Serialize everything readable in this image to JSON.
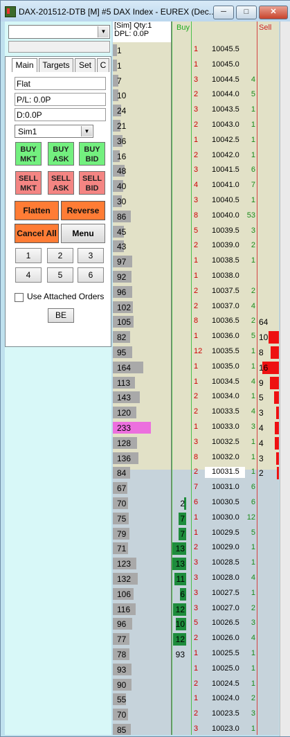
{
  "window": {
    "title": "DAX-201512-DTB [M]  #5  DAX Index - EUREX (Dec...",
    "min_label": "─",
    "max_label": "□",
    "close_label": "✕"
  },
  "left": {
    "account_combo": "",
    "tabs": [
      "Main",
      "Targets",
      "Set",
      "C"
    ],
    "position": "Flat",
    "pl": "P/L: 0.0P",
    "d": "D:0.0P",
    "account": "Sim1",
    "buy_mkt": [
      "BUY",
      "MKT"
    ],
    "buy_ask": [
      "BUY",
      "ASK"
    ],
    "buy_bid": [
      "BUY",
      "BID"
    ],
    "sell_mkt": [
      "SELL",
      "MKT"
    ],
    "sell_ask": [
      "SELL",
      "ASK"
    ],
    "sell_bid": [
      "SELL",
      "BID"
    ],
    "flatten": "Flatten",
    "reverse": "Reverse",
    "cancel_all": "Cancel All",
    "menu": "Menu",
    "qty_buttons": [
      "1",
      "2",
      "3",
      "4",
      "5",
      "6"
    ],
    "use_attached": "Use Attached Orders",
    "be": "BE"
  },
  "ladder": {
    "header_sim": "[Sim]  Qty:1",
    "header_dpl": "DPL: 0.0P",
    "buy_header": "Buy",
    "sell_header": "Sell",
    "colors": {
      "bid": "#cc0000",
      "ask": "#1a8a1a",
      "buy_bar": "#1e8c3c",
      "sell_bar": "#ee1111",
      "highlight": "#ec6fde"
    },
    "rows": [
      {
        "vol": "1",
        "price": "10045.5",
        "bid": "1",
        "ask": "",
        "buy": "",
        "sell": ""
      },
      {
        "vol": "1",
        "price": "10045.0",
        "bid": "1",
        "ask": "",
        "buy": "",
        "sell": ""
      },
      {
        "vol": "7",
        "price": "10044.5",
        "bid": "3",
        "ask": "4",
        "buy": "",
        "sell": ""
      },
      {
        "vol": "10",
        "price": "10044.0",
        "bid": "2",
        "ask": "5",
        "buy": "",
        "sell": ""
      },
      {
        "vol": "24",
        "price": "10043.5",
        "bid": "3",
        "ask": "1",
        "buy": "",
        "sell": ""
      },
      {
        "vol": "21",
        "price": "10043.0",
        "bid": "2",
        "ask": "1",
        "buy": "",
        "sell": ""
      },
      {
        "vol": "36",
        "price": "10042.5",
        "bid": "1",
        "ask": "1",
        "buy": "",
        "sell": ""
      },
      {
        "vol": "16",
        "price": "10042.0",
        "bid": "2",
        "ask": "1",
        "buy": "",
        "sell": ""
      },
      {
        "vol": "48",
        "price": "10041.5",
        "bid": "3",
        "ask": "6",
        "buy": "",
        "sell": ""
      },
      {
        "vol": "40",
        "price": "10041.0",
        "bid": "4",
        "ask": "7",
        "buy": "",
        "sell": ""
      },
      {
        "vol": "30",
        "price": "10040.5",
        "bid": "3",
        "ask": "1",
        "buy": "",
        "sell": ""
      },
      {
        "vol": "86",
        "price": "10040.0",
        "bid": "8",
        "ask": "53",
        "buy": "",
        "sell": ""
      },
      {
        "vol": "45",
        "price": "10039.5",
        "bid": "5",
        "ask": "3",
        "buy": "",
        "sell": ""
      },
      {
        "vol": "43",
        "price": "10039.0",
        "bid": "2",
        "ask": "2",
        "buy": "",
        "sell": ""
      },
      {
        "vol": "97",
        "price": "10038.5",
        "bid": "1",
        "ask": "1",
        "buy": "",
        "sell": ""
      },
      {
        "vol": "92",
        "price": "10038.0",
        "bid": "1",
        "ask": "",
        "buy": "",
        "sell": ""
      },
      {
        "vol": "96",
        "price": "10037.5",
        "bid": "2",
        "ask": "2",
        "buy": "",
        "sell": ""
      },
      {
        "vol": "102",
        "price": "10037.0",
        "bid": "2",
        "ask": "4",
        "buy": "",
        "sell": ""
      },
      {
        "vol": "105",
        "price": "10036.5",
        "bid": "8",
        "ask": "2",
        "buy": "",
        "sell": "64"
      },
      {
        "vol": "82",
        "price": "10036.0",
        "bid": "1",
        "ask": "5",
        "buy": "",
        "sell": "10"
      },
      {
        "vol": "95",
        "price": "10035.5",
        "bid": "12",
        "ask": "1",
        "buy": "",
        "sell": "8"
      },
      {
        "vol": "164",
        "price": "10035.0",
        "bid": "1",
        "ask": "1",
        "buy": "",
        "sell": "16"
      },
      {
        "vol": "113",
        "price": "10034.5",
        "bid": "1",
        "ask": "4",
        "buy": "",
        "sell": "9"
      },
      {
        "vol": "143",
        "price": "10034.0",
        "bid": "2",
        "ask": "1",
        "buy": "",
        "sell": "5"
      },
      {
        "vol": "120",
        "price": "10033.5",
        "bid": "2",
        "ask": "4",
        "buy": "",
        "sell": "3"
      },
      {
        "vol": "233",
        "price": "10033.0",
        "bid": "1",
        "ask": "3",
        "buy": "",
        "sell": "4"
      },
      {
        "vol": "128",
        "price": "10032.5",
        "bid": "3",
        "ask": "1",
        "buy": "",
        "sell": "4"
      },
      {
        "vol": "136",
        "price": "10032.0",
        "bid": "8",
        "ask": "1",
        "buy": "",
        "sell": "3"
      },
      {
        "vol": "84",
        "price": "10031.5",
        "bid": "2",
        "ask": "1",
        "buy": "",
        "sell": "2"
      },
      {
        "vol": "67",
        "price": "10031.0",
        "bid": "7",
        "ask": "6",
        "buy": "",
        "sell": ""
      },
      {
        "vol": "70",
        "price": "10030.5",
        "bid": "6",
        "ask": "6",
        "buy": "2",
        "sell": ""
      },
      {
        "vol": "75",
        "price": "10030.0",
        "bid": "1",
        "ask": "12",
        "buy": "7",
        "sell": ""
      },
      {
        "vol": "79",
        "price": "10029.5",
        "bid": "1",
        "ask": "5",
        "buy": "7",
        "sell": ""
      },
      {
        "vol": "71",
        "price": "10029.0",
        "bid": "2",
        "ask": "1",
        "buy": "13",
        "sell": ""
      },
      {
        "vol": "123",
        "price": "10028.5",
        "bid": "3",
        "ask": "1",
        "buy": "13",
        "sell": ""
      },
      {
        "vol": "132",
        "price": "10028.0",
        "bid": "3",
        "ask": "4",
        "buy": "11",
        "sell": ""
      },
      {
        "vol": "106",
        "price": "10027.5",
        "bid": "3",
        "ask": "1",
        "buy": "6",
        "sell": ""
      },
      {
        "vol": "116",
        "price": "10027.0",
        "bid": "3",
        "ask": "2",
        "buy": "12",
        "sell": ""
      },
      {
        "vol": "96",
        "price": "10026.5",
        "bid": "5",
        "ask": "3",
        "buy": "10",
        "sell": ""
      },
      {
        "vol": "77",
        "price": "10026.0",
        "bid": "2",
        "ask": "4",
        "buy": "12",
        "sell": ""
      },
      {
        "vol": "78",
        "price": "10025.5",
        "bid": "1",
        "ask": "1",
        "buy": "93",
        "sell": ""
      },
      {
        "vol": "93",
        "price": "10025.0",
        "bid": "1",
        "ask": "1",
        "buy": "",
        "sell": ""
      },
      {
        "vol": "90",
        "price": "10024.5",
        "bid": "2",
        "ask": "1",
        "buy": "",
        "sell": ""
      },
      {
        "vol": "55",
        "price": "10024.0",
        "bid": "1",
        "ask": "2",
        "buy": "",
        "sell": ""
      },
      {
        "vol": "70",
        "price": "10023.5",
        "bid": "2",
        "ask": "3",
        "buy": "",
        "sell": ""
      },
      {
        "vol": "85",
        "price": "10023.0",
        "bid": "3",
        "ask": "1",
        "buy": "",
        "sell": ""
      },
      {
        "vol": "",
        "price": "",
        "bid": "",
        "ask": "",
        "buy": "",
        "sell": ""
      }
    ],
    "last_price": "10031.5",
    "highlight_vol": "233"
  }
}
